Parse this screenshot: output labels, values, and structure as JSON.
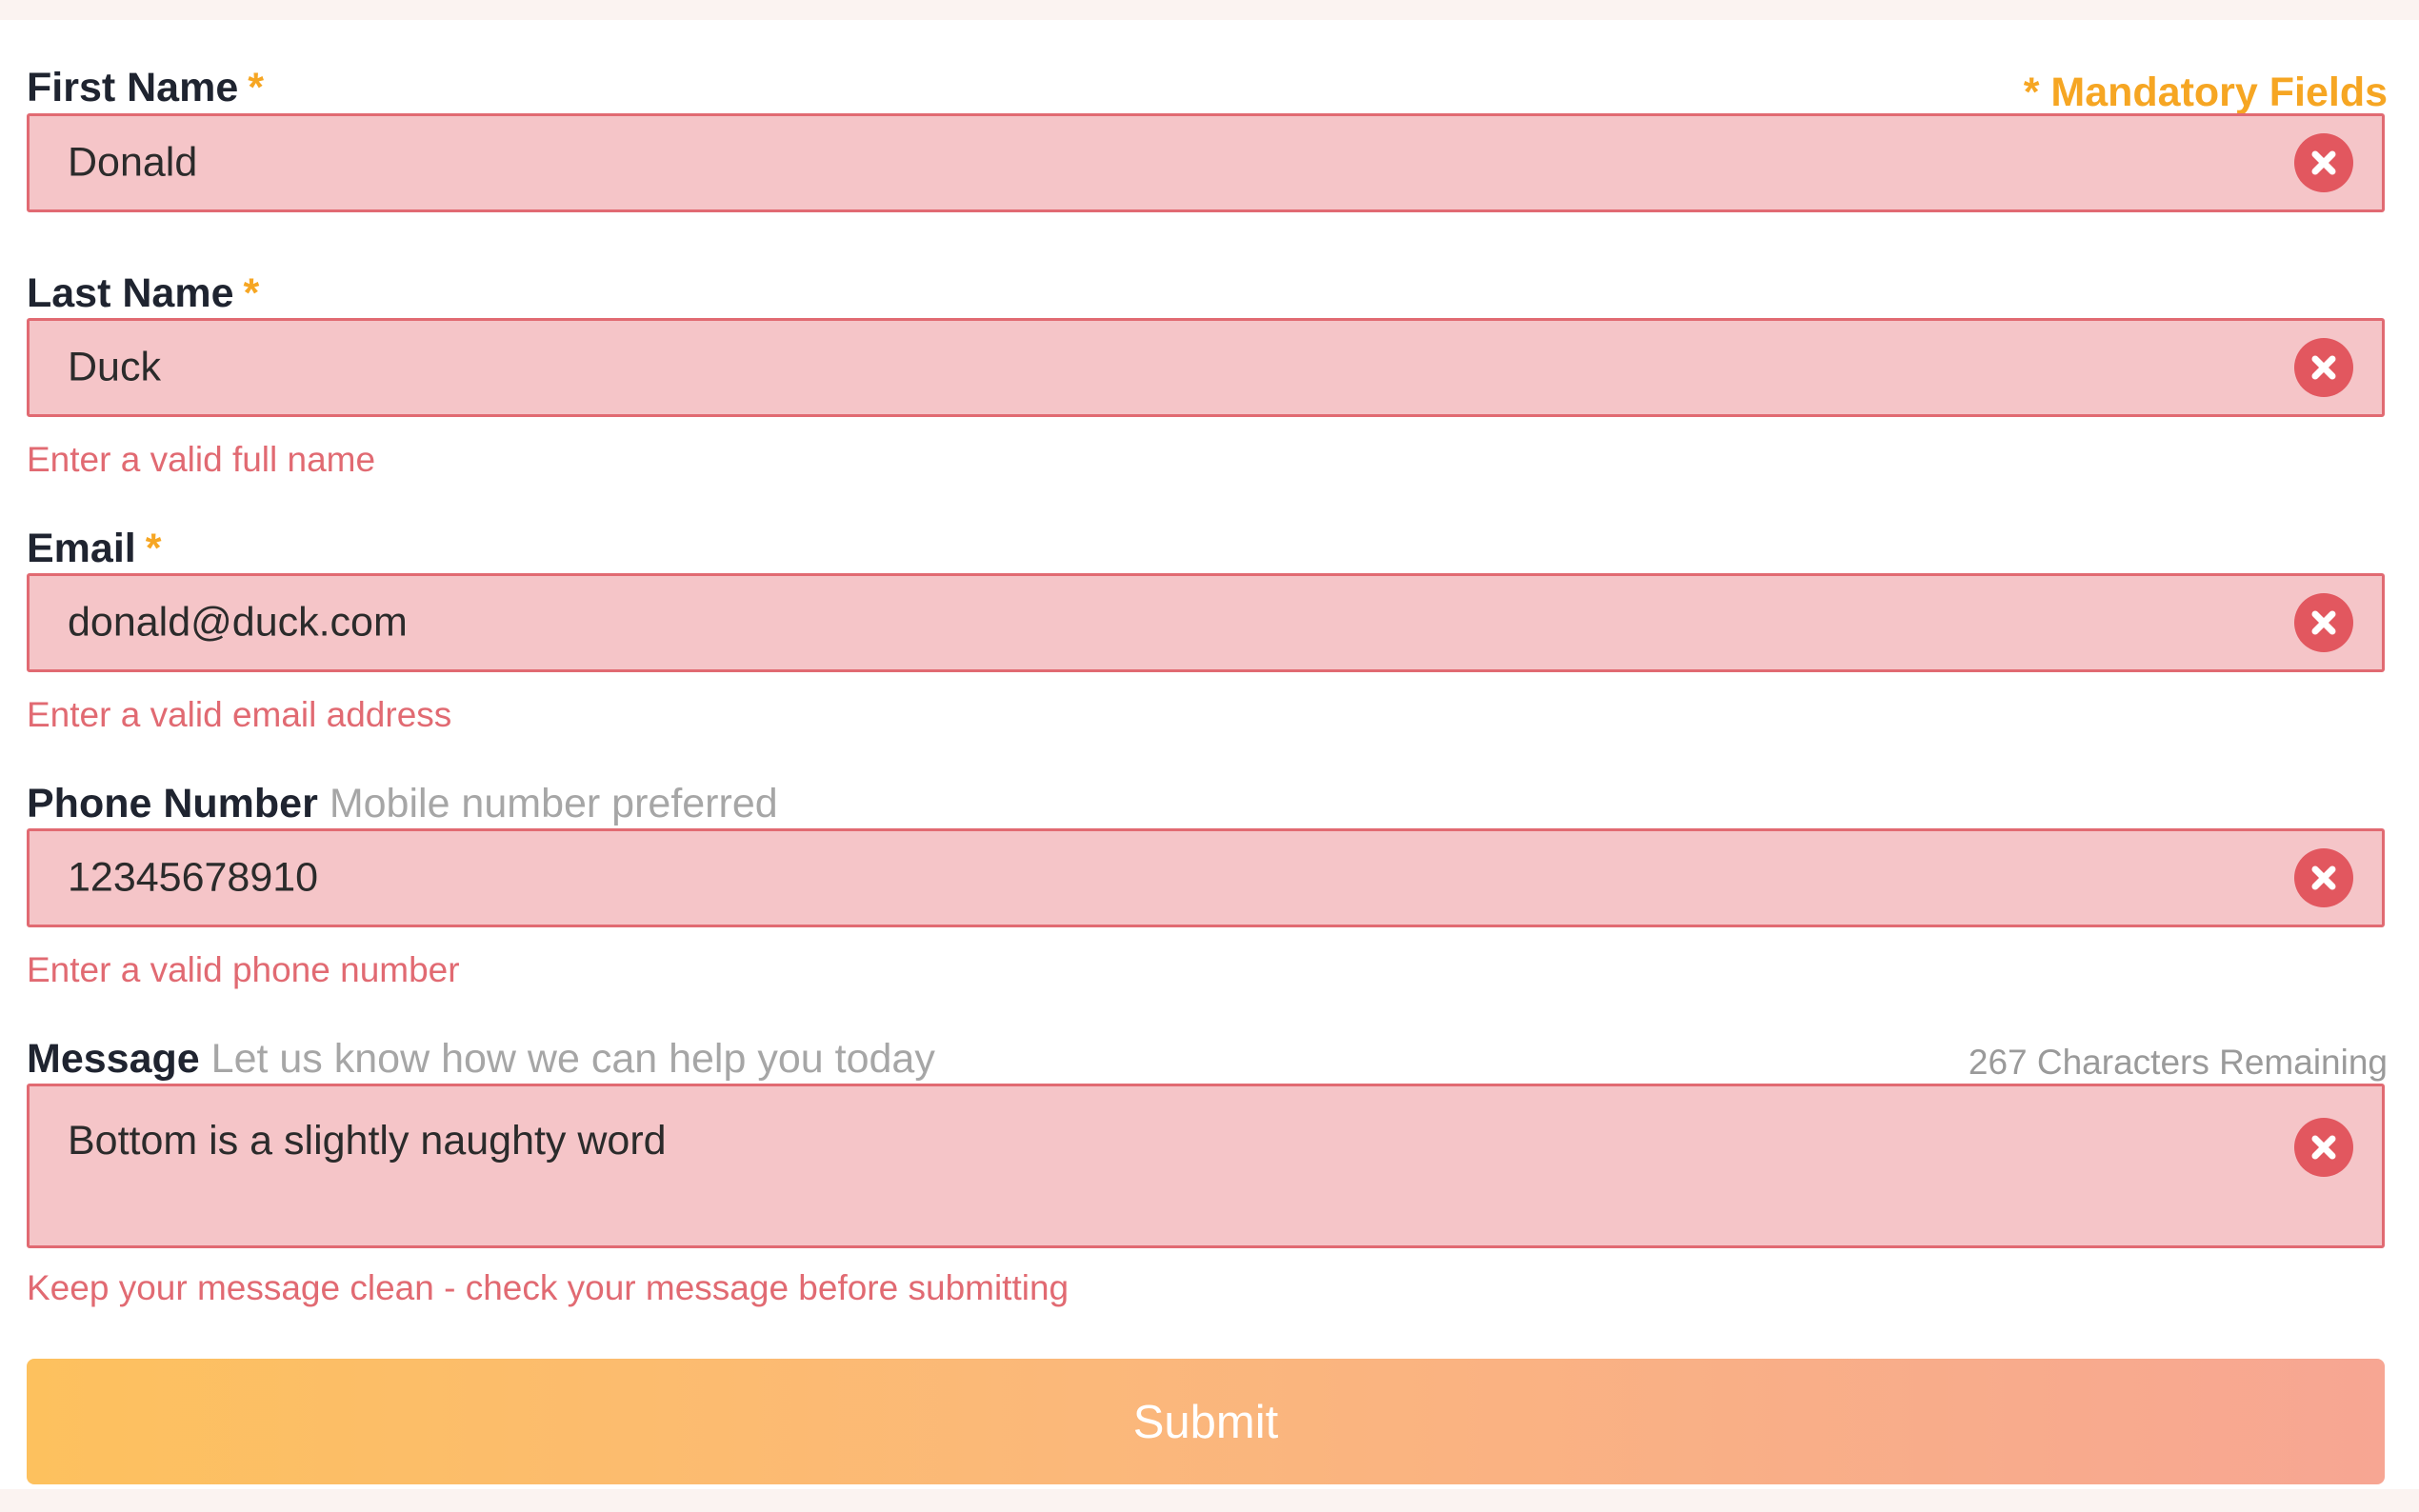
{
  "form": {
    "mandatory_note": "* Mandatory Fields",
    "required_marker": "*",
    "submit_label": "Submit",
    "chars_remaining": "267 Characters Remaining",
    "first_name": {
      "label": "First Name",
      "value": "Donald"
    },
    "last_name": {
      "label": "Last Name",
      "value": "Duck",
      "error": "Enter a valid full name"
    },
    "email": {
      "label": "Email",
      "value": "donald@duck.com",
      "error": "Enter a valid email address"
    },
    "phone": {
      "label": "Phone Number",
      "hint": "Mobile number preferred",
      "value": "12345678910",
      "error": "Enter a valid phone number"
    },
    "message": {
      "label": "Message",
      "hint": "Let us know how we can help you today",
      "value": "Bottom is a slightly naughty word",
      "error": "Keep your message clean - check your message before submitting"
    }
  },
  "icons": {
    "clear": "clear-icon"
  },
  "colors": {
    "accent": "#f6a623",
    "error": "#e16a72",
    "field_error_bg": "#f5c5c8",
    "label": "#1f2430",
    "hint": "#a6a6a6"
  }
}
